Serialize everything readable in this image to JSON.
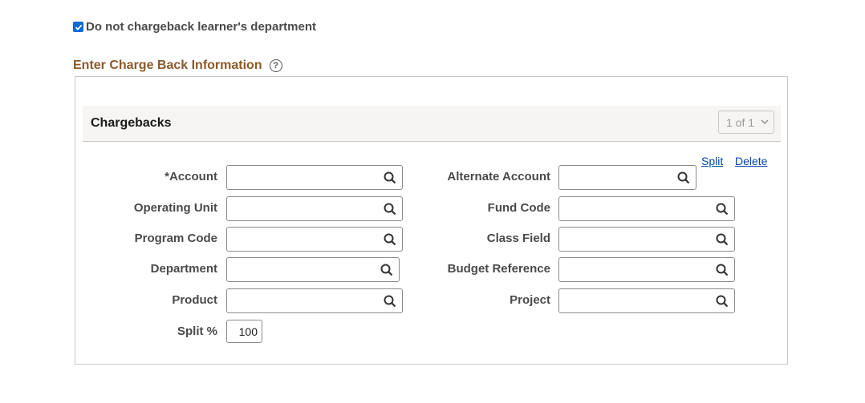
{
  "chargeback_option": {
    "checked": true,
    "label": "Do not chargeback learner's department"
  },
  "section": {
    "title": "Enter Charge Back Information",
    "help_icon": "help-circle-icon"
  },
  "grid": {
    "title": "Chargebacks",
    "pager": "1 of 1",
    "links": {
      "split": "Split",
      "delete": "Delete"
    }
  },
  "left_fields": [
    {
      "label": "*Account",
      "value": ""
    },
    {
      "label": "Operating Unit",
      "value": ""
    },
    {
      "label": "Program Code",
      "value": ""
    },
    {
      "label": "Department",
      "value": ""
    },
    {
      "label": "Product",
      "value": ""
    }
  ],
  "right_fields": [
    {
      "label": "Alternate Account",
      "value": ""
    },
    {
      "label": "Fund Code",
      "value": ""
    },
    {
      "label": "Class Field",
      "value": ""
    },
    {
      "label": "Budget Reference",
      "value": ""
    },
    {
      "label": "Project",
      "value": ""
    }
  ],
  "split_percent": {
    "label": "Split %",
    "value": "100"
  },
  "icons": {
    "lookup": "search-icon",
    "pager_chevron": "chevron-down-icon"
  },
  "colors": {
    "section_title": "#8b5a2b",
    "link": "#0645ad",
    "checkbox": "#0a6ad6",
    "header_bg": "#f6f5f3"
  }
}
